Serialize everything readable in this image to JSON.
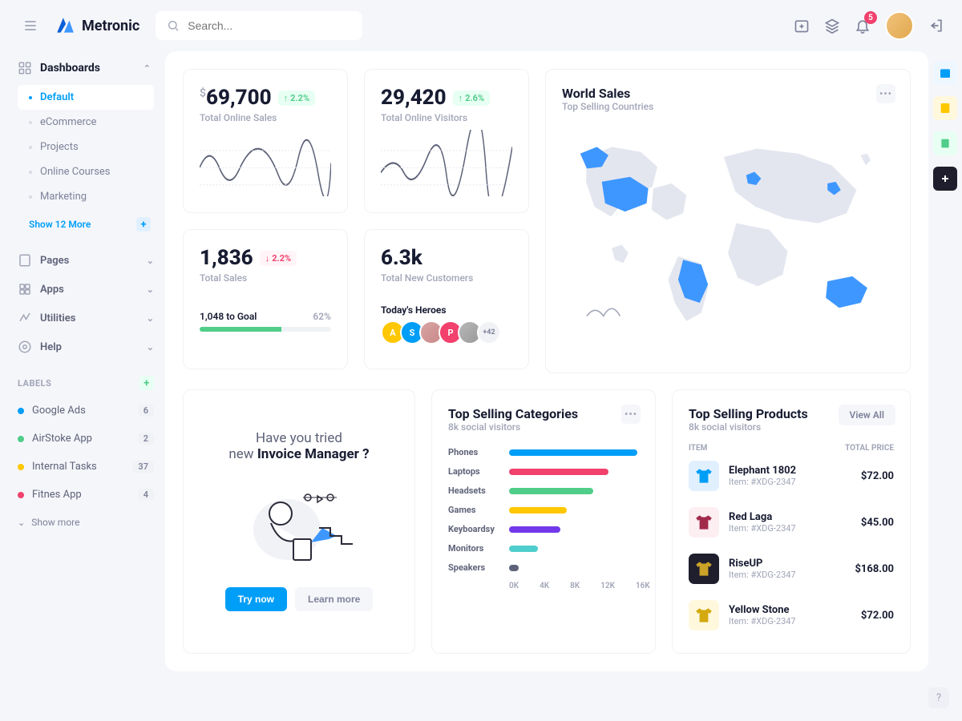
{
  "brand": "Metronic",
  "search": {
    "placeholder": "Search..."
  },
  "topbar": {
    "notifications_count": "5"
  },
  "sidebar": {
    "dashboards_label": "Dashboards",
    "items": [
      "Default",
      "eCommerce",
      "Projects",
      "Online Courses",
      "Marketing"
    ],
    "show_more": "Show 12 More",
    "nav": [
      "Pages",
      "Apps",
      "Utilities",
      "Help"
    ],
    "labels_title": "LABELS",
    "labels": [
      {
        "name": "Google Ads",
        "color": "#009ef7",
        "count": "6"
      },
      {
        "name": "AirStoke App",
        "color": "#50cd89",
        "count": "2"
      },
      {
        "name": "Internal Tasks",
        "color": "#ffc700",
        "count": "37"
      },
      {
        "name": "Fitnes App",
        "color": "#f1416c",
        "count": "4"
      }
    ],
    "show_more_labels": "Show more"
  },
  "kpis": {
    "sales_online": {
      "value": "69,700",
      "change": "2.2%",
      "label": "Total Online Sales"
    },
    "visitors": {
      "value": "29,420",
      "change": "2.6%",
      "label": "Total Online Visitors"
    },
    "total_sales": {
      "value": "1,836",
      "change": "2.2%",
      "label": "Total Sales",
      "goal_text": "1,048 to Goal",
      "goal_pct": "62%"
    },
    "new_customers": {
      "value": "6.3k",
      "label": "Total New Customers",
      "heroes_title": "Today's Heroes",
      "heroes": [
        "A",
        "S",
        "",
        "P",
        ""
      ],
      "heroes_more": "+42"
    }
  },
  "world": {
    "title": "World Sales",
    "subtitle": "Top Selling Countries"
  },
  "promo": {
    "line1": "Have you tried",
    "line2_a": "new ",
    "line2_b": "Invoice Manager ?",
    "try": "Try now",
    "learn": "Learn more"
  },
  "categories": {
    "title": "Top Selling Categories",
    "subtitle": "8k social visitors",
    "axis": [
      "0K",
      "4K",
      "8K",
      "12K",
      "16K"
    ]
  },
  "chart_data": {
    "type": "bar",
    "orientation": "horizontal",
    "categories": [
      "Phones",
      "Laptops",
      "Headsets",
      "Games",
      "Keyboardsy",
      "Monitors",
      "Speakers"
    ],
    "values": [
      15500,
      12000,
      10200,
      7000,
      6200,
      3500,
      1200
    ],
    "colors": [
      "#009ef7",
      "#f1416c",
      "#50cd89",
      "#ffc700",
      "#7239ea",
      "#50cdcd",
      "#5e6278"
    ],
    "xlabel": "",
    "ylabel": "",
    "xlim": [
      0,
      16000
    ],
    "title": "Top Selling Categories"
  },
  "products": {
    "title": "Top Selling Products",
    "subtitle": "8k social visitors",
    "view_all": "View All",
    "head_item": "ITEM",
    "head_price": "TOTAL PRICE",
    "rows": [
      {
        "name": "Elephant 1802",
        "sku": "Item: #XDG-2347",
        "price": "$72.00",
        "bg": "#e1f0ff",
        "fg": "#009ef7"
      },
      {
        "name": "Red Laga",
        "sku": "Item: #XDG-2347",
        "price": "$45.00",
        "bg": "#fdeef2",
        "fg": "#a12a4a"
      },
      {
        "name": "RiseUP",
        "sku": "Item: #XDG-2347",
        "price": "$168.00",
        "bg": "#1e1e2d",
        "fg": "#c9a227"
      },
      {
        "name": "Yellow Stone",
        "sku": "Item: #XDG-2347",
        "price": "$72.00",
        "bg": "#fff8dd",
        "fg": "#d4a90f"
      }
    ]
  }
}
